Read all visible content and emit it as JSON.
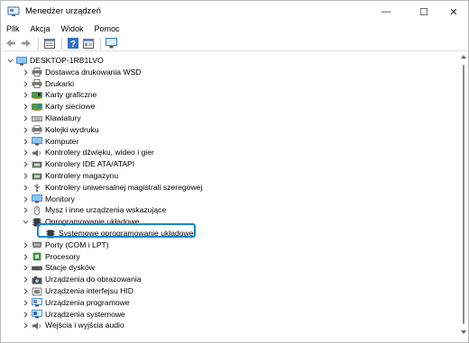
{
  "window": {
    "title": "Menedżer urządzeń",
    "min_glyph": "—",
    "max_glyph": "☐",
    "close_glyph": "✕"
  },
  "menu": [
    "Plik",
    "Akcja",
    "Widok",
    "Pomoc"
  ],
  "toolbar": [
    "back-icon",
    "forward-icon",
    "properties-icon",
    "help-icon",
    "view-icon",
    "monitor-scan-icon"
  ],
  "tree": {
    "root": "DESKTOP-1RB1LVO",
    "categories": [
      {
        "label": "Dostawca drukowania WSD",
        "icon": "printer-icon"
      },
      {
        "label": "Drukarki",
        "icon": "printer-icon"
      },
      {
        "label": "Karty graficzne",
        "icon": "display-adapter-icon"
      },
      {
        "label": "Karty sieciowe",
        "icon": "network-adapter-icon"
      },
      {
        "label": "Klawiatury",
        "icon": "keyboard-icon"
      },
      {
        "label": "Kolejki wydruku",
        "icon": "print-queue-icon"
      },
      {
        "label": "Komputer",
        "icon": "computer-icon"
      },
      {
        "label": "Kontrolery dźwięku, wideo i gier",
        "icon": "sound-icon"
      },
      {
        "label": "Kontrolery IDE ATA/ATAPI",
        "icon": "ide-controller-icon"
      },
      {
        "label": "Kontrolery magazynu",
        "icon": "storage-controller-icon"
      },
      {
        "label": "Kontrolery uniwersalnej magistrali szeregowej",
        "icon": "usb-icon"
      },
      {
        "label": "Monitory",
        "icon": "monitor-icon"
      },
      {
        "label": "Mysz i inne urządzenia wskazujące",
        "icon": "mouse-icon"
      },
      {
        "label": "Oprogramowanie układowe",
        "icon": "firmware-icon",
        "expanded": true
      },
      {
        "label": "Systemowe oprogramowanie układowe",
        "icon": "firmware-icon",
        "child": true,
        "selected": true
      },
      {
        "label": "Porty (COM i LPT)",
        "icon": "port-icon"
      },
      {
        "label": "Procesory",
        "icon": "processor-icon"
      },
      {
        "label": "Stacje dysków",
        "icon": "disk-drive-icon"
      },
      {
        "label": "Urządzenia do obrazowania",
        "icon": "camera-icon"
      },
      {
        "label": "Urządzenia interfejsu HID",
        "icon": "hid-icon"
      },
      {
        "label": "Urządzenia programowe",
        "icon": "software-device-icon"
      },
      {
        "label": "Urządzenia systemowe",
        "icon": "system-device-icon"
      },
      {
        "label": "Wejścia i wyjścia audio",
        "icon": "audio-io-icon"
      }
    ]
  },
  "colors": {
    "selection_border": "#1b86c9",
    "icon_blue": "#2a7fd4",
    "icon_gray": "#5a5a5a"
  }
}
